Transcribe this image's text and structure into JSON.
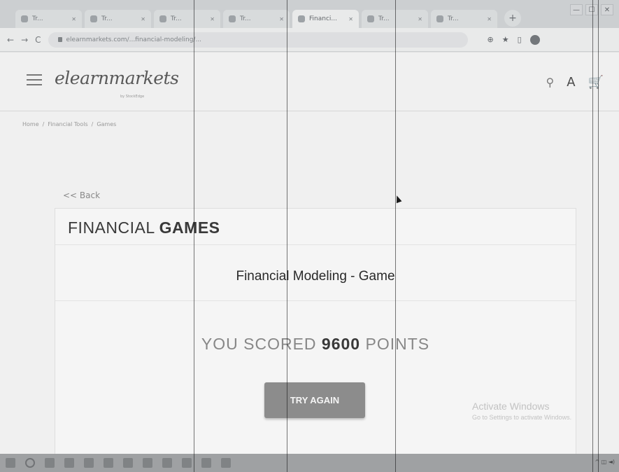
{
  "browser": {
    "tabs": [
      {
        "label": "Tr..."
      },
      {
        "label": "Tr..."
      },
      {
        "label": "Tr..."
      },
      {
        "label": "Tr..."
      },
      {
        "label": "Financi...",
        "active": true
      },
      {
        "label": "Tr..."
      },
      {
        "label": "Tr..."
      }
    ],
    "url": "elearnmarkets.com/...financial-modeling/...",
    "window_controls": [
      "—",
      "☐",
      "✕"
    ]
  },
  "site": {
    "logo": "elearnmarkets",
    "logo_sub": "by StockEdge",
    "breadcrumb": [
      "Home",
      "/",
      "Financial Tools",
      "/",
      "Games"
    ],
    "back_label": "<< Back",
    "section_title_light": "FINANCIAL ",
    "section_title_bold": "GAMES",
    "game_title": "Financial Modeling - Game",
    "score_prefix": "YOU SCORED ",
    "score_value": "9600",
    "score_suffix": " POINTS",
    "try_again_label": "TRY AGAIN"
  },
  "watermark": {
    "title": "Activate Windows",
    "line1": "Go to Settings to activate Windows."
  },
  "icons": {
    "menu": "hamburger-icon",
    "search": "search-icon",
    "account": "user-icon",
    "cart": "cart-icon"
  }
}
